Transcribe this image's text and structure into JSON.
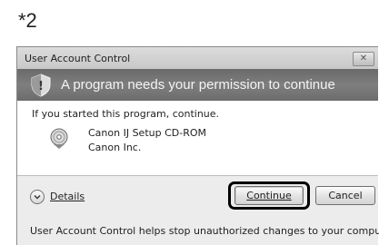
{
  "note": {
    "label": "*2"
  },
  "dialog": {
    "title": "User Account Control",
    "close_symbol": "✕",
    "banner": "A program needs your permission to continue",
    "banner_icon": "shield-icon",
    "prompt": "If you started this program, continue.",
    "program": {
      "icon": "cd-rom-icon",
      "name": "Canon IJ Setup CD-ROM",
      "publisher": "Canon Inc."
    },
    "details_label": "Details",
    "buttons": {
      "continue": "Continue",
      "cancel": "Cancel"
    },
    "footer": "User Account Control helps stop unauthorized changes to your computer.",
    "colors": {
      "banner": "#757575",
      "content": "#ffffff",
      "chrome": "#ececec",
      "highlight_ring": "#000000"
    }
  }
}
